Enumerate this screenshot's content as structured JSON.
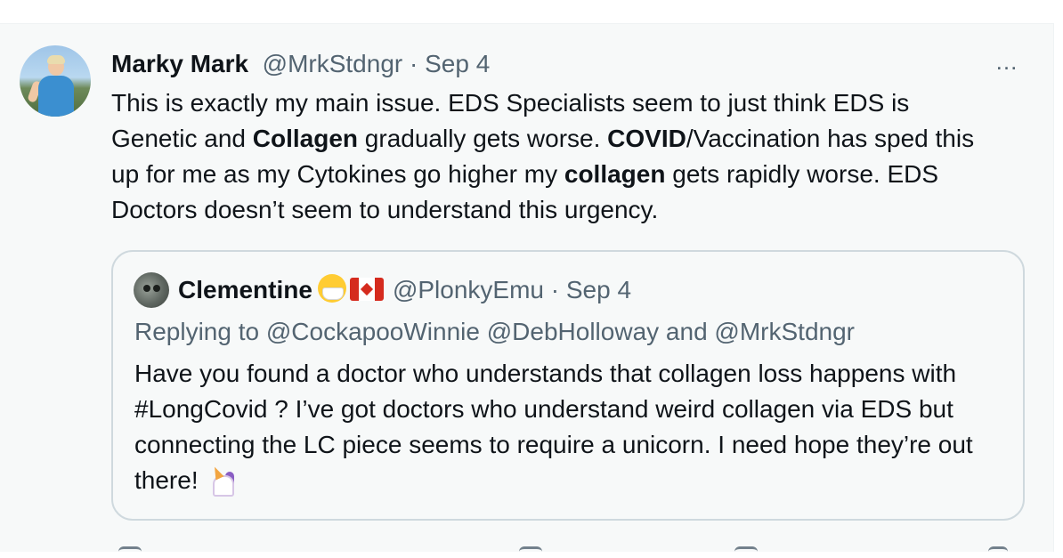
{
  "tweet": {
    "author_name": "Marky Mark",
    "handle": "@MrkStdngr",
    "separator": " · ",
    "date": "Sep 4",
    "more_icon": "…",
    "text": {
      "s1": "This is exactly my main issue. EDS Specialists seem to just think EDS is Genetic and ",
      "b1": "Collagen",
      "s2": " gradually gets worse. ",
      "b2": "COVID",
      "s3": "/Vaccination has sped this up for me as my Cytokines go higher my ",
      "b3": "collagen",
      "s4": " gets rapidly worse. EDS Doctors doesn’t seem to understand this urgency."
    }
  },
  "quoted_tweet": {
    "author_name": "Clementine",
    "handle": "@PlonkyEmu",
    "separator": " · ",
    "date": "Sep 4",
    "emoji_1": "face-with-medical-mask",
    "emoji_2": "flag-canada",
    "replying_prefix": "Replying to ",
    "replying_users": "@CockapooWinnie @DebHolloway",
    "replying_and": " and ",
    "replying_last": "@MrkStdngr",
    "text": "Have you found a doctor who understands that collagen loss happens with #LongCovid ? I’ve got doctors who understand weird collagen via EDS but connecting the LC piece seems to require a unicorn. I need hope they’re out there!",
    "trailing_emoji": "unicorn"
  },
  "colors": {
    "text_primary": "#0f1419",
    "text_secondary": "#536471",
    "border": "#cfd9de",
    "background_hover": "#f7f9f9"
  }
}
